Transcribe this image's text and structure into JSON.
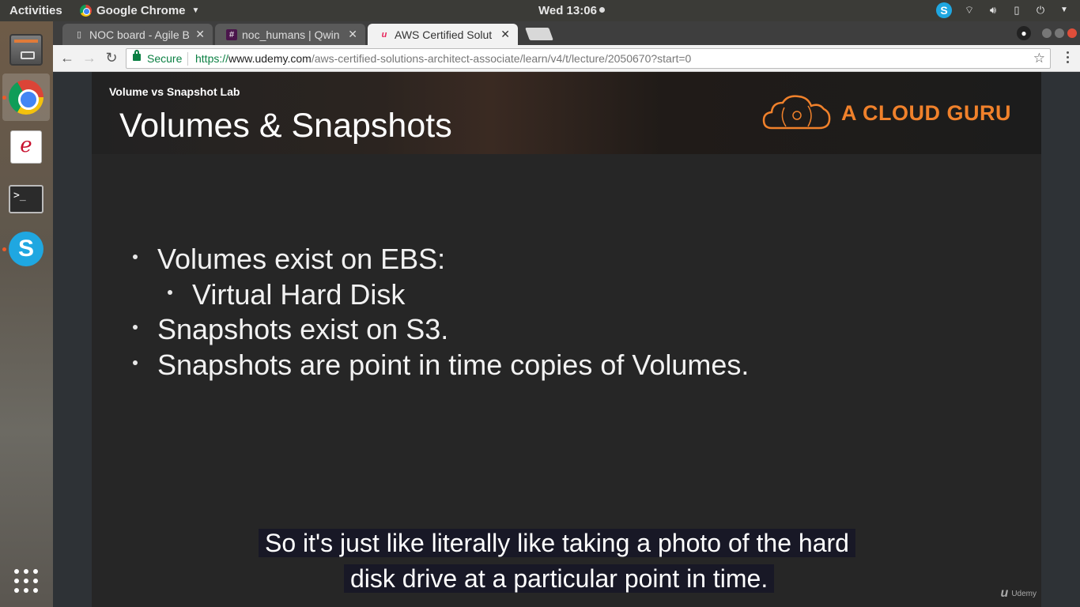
{
  "topbar": {
    "activities": "Activities",
    "app_name": "Google Chrome",
    "clock": "Wed 13:06"
  },
  "launcher": {
    "items": [
      "files",
      "google-chrome",
      "libreoffice-writer",
      "terminal",
      "skype",
      "show-applications"
    ]
  },
  "tabs": [
    {
      "title": "NOC board - Agile B",
      "favicon": "page-icon",
      "active": false
    },
    {
      "title": "noc_humans | Qwin",
      "favicon": "slack-icon",
      "active": false
    },
    {
      "title": "AWS Certified Solut",
      "favicon": "udemy-icon",
      "active": true
    }
  ],
  "address_bar": {
    "secure_label": "Secure",
    "scheme": "https://",
    "host": "www.udemy.com",
    "path": "/aws-certified-solutions-architect-associate/learn/v4/t/lecture/2050670?start=0"
  },
  "slide": {
    "lab_label": "Volume vs Snapshot Lab",
    "title": "Volumes & Snapshots",
    "logo_text": "A CLOUD GURU",
    "bullets": [
      {
        "level": 1,
        "text": "Volumes exist on EBS:"
      },
      {
        "level": 2,
        "text": "Virtual Hard Disk"
      },
      {
        "level": 1,
        "text": "Snapshots exist on S3."
      },
      {
        "level": 1,
        "text": "Snapshots are point in time copies of Volumes."
      }
    ]
  },
  "captions": {
    "line1": "So it's just like literally like taking a photo of the hard",
    "line2": "disk drive at a particular point in time."
  },
  "watermark": "Udemy",
  "colors": {
    "brand_orange": "#f0812b",
    "secure_green": "#0b8043"
  }
}
